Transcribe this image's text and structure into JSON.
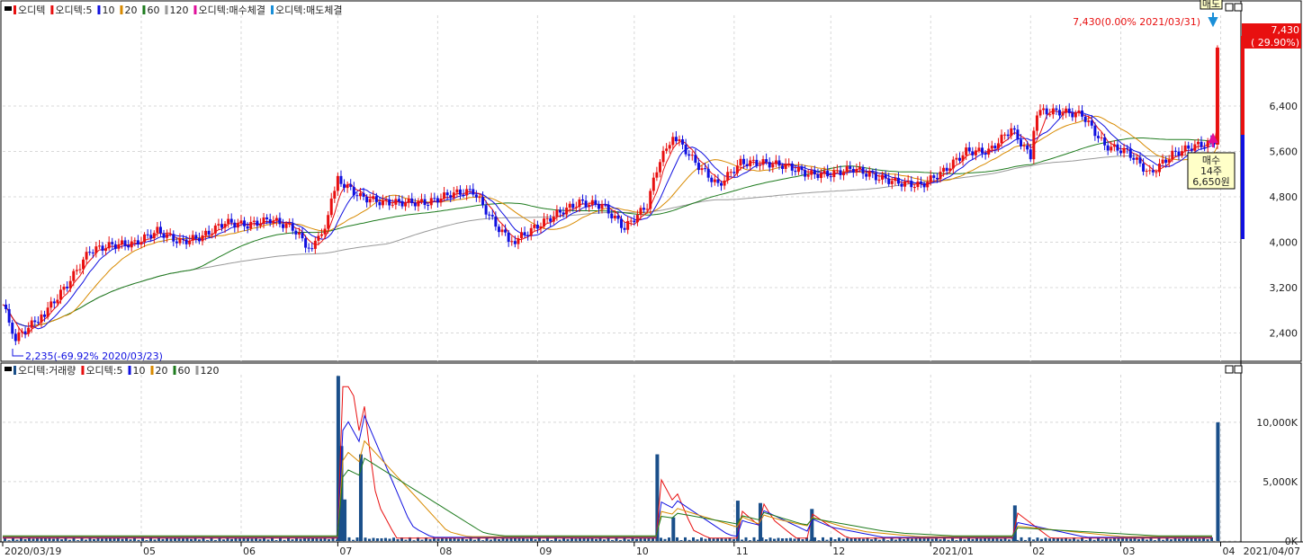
{
  "price_legend": [
    {
      "label": "오디텍",
      "color": "#e81010"
    },
    {
      "label": "오디텍:5",
      "color": "#e81010"
    },
    {
      "label": "10",
      "color": "#1010e0"
    },
    {
      "label": "20",
      "color": "#d88a00"
    },
    {
      "label": "60",
      "color": "#1e7b1e"
    },
    {
      "label": "120",
      "color": "#999999"
    },
    {
      "label": "오디텍:매수체결",
      "color": "#e0109a"
    },
    {
      "label": "오디텍:매도체결",
      "color": "#1a8fd8"
    }
  ],
  "volume_legend": [
    {
      "label": "오디텍:거래량",
      "color": "#1a4f8a"
    },
    {
      "label": "오디텍:5",
      "color": "#e81010"
    },
    {
      "label": "10",
      "color": "#1010e0"
    },
    {
      "label": "20",
      "color": "#d88a00"
    },
    {
      "label": "60",
      "color": "#1e7b1e"
    },
    {
      "label": "120",
      "color": "#999999"
    }
  ],
  "annotations": {
    "high_label": "7,430(0.00% 2021/03/31)",
    "low_label": "2,235(-69.92% 2020/03/23)",
    "last_price": "7,430",
    "last_change": "( 29.90%)",
    "sell_tag": "매도",
    "buy_tag": [
      "매수",
      "14주",
      "6,650원"
    ]
  },
  "colors": {
    "up": "#e81010",
    "down": "#1010e0",
    "ma5": "#e81010",
    "ma10": "#1010e0",
    "ma20": "#d88a00",
    "ma60": "#1e7b1e",
    "ma120": "#999999",
    "volume": "#1a4f8a",
    "grid": "#d8d8d8",
    "buy": "#e0109a",
    "sell": "#1a8fd8",
    "tag_bg": "#ffffc8"
  },
  "chart_data": [
    {
      "type": "candlestick",
      "title": "오디텍",
      "x_start": "2020/03/19",
      "x_end": "2021/04/07",
      "x_ticks": [
        "2020/03/19",
        "05",
        "06",
        "07",
        "08",
        "09",
        "10",
        "11",
        "12",
        "2021/01",
        "02",
        "03",
        "04",
        "2021/04/07"
      ],
      "y_ticks": [
        "6,400",
        "5,600",
        "4,800",
        "4,000",
        "3,200",
        "2,400"
      ],
      "ylim": [
        1900,
        8000
      ],
      "grid": true,
      "close_series": [
        {
          "date": "2020/03/19",
          "close": 2900
        },
        {
          "date": "2020/03/23",
          "close": 2300
        },
        {
          "date": "2020/04/01",
          "close": 2750
        },
        {
          "date": "2020/04/08",
          "close": 3250
        },
        {
          "date": "2020/04/15",
          "close": 3850
        },
        {
          "date": "2020/04/22",
          "close": 3950
        },
        {
          "date": "2020/04/29",
          "close": 3980
        },
        {
          "date": "2020/05/06",
          "close": 4200
        },
        {
          "date": "2020/05/13",
          "close": 4000
        },
        {
          "date": "2020/05/20",
          "close": 4100
        },
        {
          "date": "2020/05/27",
          "close": 4350
        },
        {
          "date": "2020/06/03",
          "close": 4300
        },
        {
          "date": "2020/06/10",
          "close": 4400
        },
        {
          "date": "2020/06/17",
          "close": 4250
        },
        {
          "date": "2020/06/22",
          "close": 3900
        },
        {
          "date": "2020/06/26",
          "close": 4100
        },
        {
          "date": "2020/07/01",
          "close": 5100
        },
        {
          "date": "2020/07/08",
          "close": 4800
        },
        {
          "date": "2020/07/15",
          "close": 4700
        },
        {
          "date": "2020/07/22",
          "close": 4700
        },
        {
          "date": "2020/07/29",
          "close": 4700
        },
        {
          "date": "2020/08/05",
          "close": 4850
        },
        {
          "date": "2020/08/12",
          "close": 4900
        },
        {
          "date": "2020/08/19",
          "close": 4300
        },
        {
          "date": "2020/08/24",
          "close": 4000
        },
        {
          "date": "2020/08/31",
          "close": 4250
        },
        {
          "date": "2020/09/07",
          "close": 4500
        },
        {
          "date": "2020/09/14",
          "close": 4700
        },
        {
          "date": "2020/09/21",
          "close": 4650
        },
        {
          "date": "2020/09/28",
          "close": 4250
        },
        {
          "date": "2020/10/05",
          "close": 4650
        },
        {
          "date": "2020/10/08",
          "close": 5300
        },
        {
          "date": "2020/10/13",
          "close": 5900
        },
        {
          "date": "2020/10/20",
          "close": 5400
        },
        {
          "date": "2020/10/27",
          "close": 5000
        },
        {
          "date": "2020/11/03",
          "close": 5400
        },
        {
          "date": "2020/11/10",
          "close": 5400
        },
        {
          "date": "2020/11/17",
          "close": 5350
        },
        {
          "date": "2020/11/24",
          "close": 5200
        },
        {
          "date": "2020/12/01",
          "close": 5200
        },
        {
          "date": "2020/12/08",
          "close": 5300
        },
        {
          "date": "2020/12/15",
          "close": 5150
        },
        {
          "date": "2020/12/22",
          "close": 5050
        },
        {
          "date": "2020/12/29",
          "close": 5000
        },
        {
          "date": "2021/01/05",
          "close": 5250
        },
        {
          "date": "2021/01/12",
          "close": 5600
        },
        {
          "date": "2021/01/19",
          "close": 5600
        },
        {
          "date": "2021/01/26",
          "close": 6000
        },
        {
          "date": "2021/02/01",
          "close": 5500
        },
        {
          "date": "2021/02/03",
          "close": 6300
        },
        {
          "date": "2021/02/10",
          "close": 6300
        },
        {
          "date": "2021/02/17",
          "close": 6250
        },
        {
          "date": "2021/02/24",
          "close": 5700
        },
        {
          "date": "2021/03/03",
          "close": 5600
        },
        {
          "date": "2021/03/10",
          "close": 5200
        },
        {
          "date": "2021/03/17",
          "close": 5550
        },
        {
          "date": "2021/03/24",
          "close": 5700
        },
        {
          "date": "2021/03/30",
          "close": 5750
        },
        {
          "date": "2021/03/31",
          "close": 7430
        }
      ]
    },
    {
      "type": "bar",
      "title": "오디텍:거래량",
      "y_ticks": [
        "10,000K",
        "5,000K",
        "0K"
      ],
      "ylim": [
        0,
        14000
      ],
      "grid": true,
      "spikes": [
        {
          "date": "2020/07/01",
          "value": 13900
        },
        {
          "date": "2020/07/02",
          "value": 8000
        },
        {
          "date": "2020/07/03",
          "value": 3500
        },
        {
          "date": "2020/07/08",
          "value": 7300
        },
        {
          "date": "2020/10/08",
          "value": 7300
        },
        {
          "date": "2020/10/13",
          "value": 2000
        },
        {
          "date": "2020/11/02",
          "value": 3400
        },
        {
          "date": "2020/11/09",
          "value": 3200
        },
        {
          "date": "2020/11/25",
          "value": 2700
        },
        {
          "date": "2021/01/27",
          "value": 3000
        },
        {
          "date": "2021/03/31",
          "value": 10000
        }
      ]
    }
  ]
}
